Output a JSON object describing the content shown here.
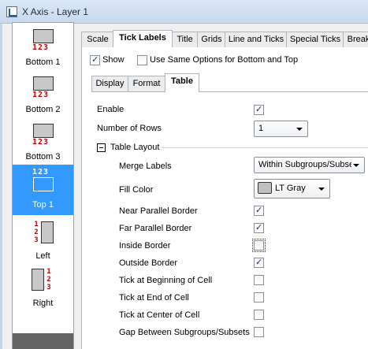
{
  "window": {
    "title": "X Axis - Layer 1"
  },
  "sidebar": {
    "items": [
      {
        "label": "Bottom 1",
        "nums": "123"
      },
      {
        "label": "Bottom 2",
        "nums": "123"
      },
      {
        "label": "Bottom 3",
        "nums": "123"
      },
      {
        "label": "Top 1",
        "nums": "123",
        "selected": true
      },
      {
        "label": "Left",
        "nums": [
          "1",
          "2",
          "3"
        ]
      },
      {
        "label": "Right",
        "nums": [
          "1",
          "2",
          "3"
        ]
      }
    ]
  },
  "tabs": [
    {
      "label": "Scale"
    },
    {
      "label": "Tick Labels",
      "active": true
    },
    {
      "label": "Title"
    },
    {
      "label": "Grids"
    },
    {
      "label": "Line and Ticks"
    },
    {
      "label": "Special Ticks"
    },
    {
      "label": "Break"
    }
  ],
  "options": {
    "show_label": "Show",
    "show_checked": true,
    "same_options_label": "Use Same Options for Bottom and Top",
    "same_options_checked": false
  },
  "subtabs": [
    {
      "label": "Display"
    },
    {
      "label": "Format"
    },
    {
      "label": "Table",
      "active": true
    }
  ],
  "table": {
    "enable_label": "Enable",
    "enable_checked": true,
    "rows_label": "Number of Rows",
    "rows_value": "1",
    "layout_label": "Table Layout",
    "merge_label": "Merge Labels",
    "merge_value": "Within Subgroups/Subsets",
    "fill_label": "Fill Color",
    "fill_value": "LT Gray",
    "fill_color": "#c0c0c0",
    "checks": [
      {
        "label": "Near Parallel Border",
        "checked": true
      },
      {
        "label": "Far Parallel Border",
        "checked": true
      },
      {
        "label": "Inside Border",
        "checked": false,
        "focused": true
      },
      {
        "label": "Outside Border",
        "checked": true
      },
      {
        "label": "Tick at Beginning of Cell",
        "checked": false
      },
      {
        "label": "Tick at End of Cell",
        "checked": false
      },
      {
        "label": "Tick at Center of Cell",
        "checked": false
      },
      {
        "label": "Gap Between Subgroups/Subsets",
        "checked": false
      }
    ]
  },
  "colors": {
    "selection": "#3399ff",
    "tick_numbers": "#c00000"
  }
}
